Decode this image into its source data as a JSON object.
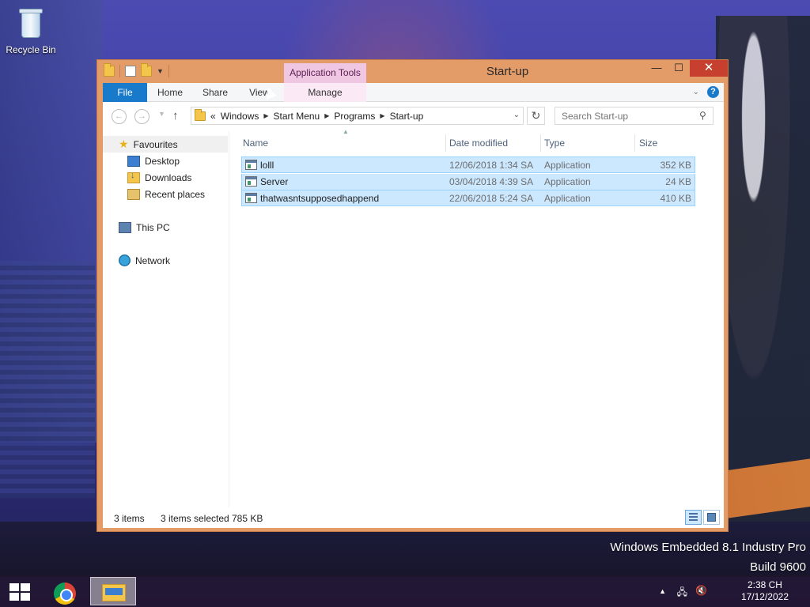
{
  "desktop": {
    "recycle_bin_label": "Recycle Bin",
    "watermark_line1": "Windows Embedded 8.1 Industry Pro",
    "watermark_line2": "Build 9600"
  },
  "window": {
    "title": "Start-up",
    "contextual_tab": "Application Tools",
    "close_glyph": "✕",
    "minimize_glyph": "—",
    "maximize_glyph": "☐"
  },
  "ribbon": {
    "tabs": [
      "File",
      "Home",
      "Share",
      "View",
      "Manage"
    ],
    "help_glyph": "?",
    "accent": "#1979ca"
  },
  "address": {
    "overflow": "«",
    "crumbs": [
      "Windows",
      "Start Menu",
      "Programs",
      "Start-up"
    ],
    "search_placeholder": "Search Start-up"
  },
  "navpane": {
    "favourites": "Favourites",
    "items": [
      "Desktop",
      "Downloads",
      "Recent places"
    ],
    "this_pc": "This PC",
    "network": "Network"
  },
  "columns": {
    "name": "Name",
    "date": "Date modified",
    "type": "Type",
    "size": "Size"
  },
  "files": [
    {
      "name": "lolll",
      "date": "12/06/2018 1:34 SA",
      "type": "Application",
      "size": "352 KB"
    },
    {
      "name": "Server",
      "date": "03/04/2018 4:39 SA",
      "type": "Application",
      "size": "24 KB"
    },
    {
      "name": "thatwasntsupposedhappend",
      "date": "22/06/2018 5:24 SA",
      "type": "Application",
      "size": "410 KB"
    }
  ],
  "status": {
    "items": "3 items",
    "selected": "3 items selected",
    "selected_size": "785 KB"
  },
  "taskbar": {
    "time": "2:38 CH",
    "date": "17/12/2022",
    "tray_arrow": "▲"
  }
}
